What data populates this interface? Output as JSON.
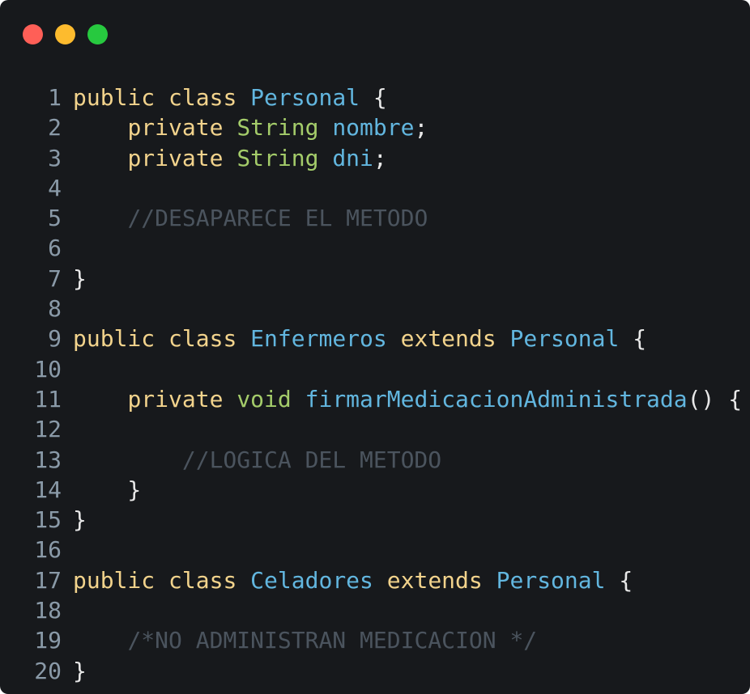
{
  "window": {
    "controls": [
      "close-button",
      "minimize-button",
      "maximize-button"
    ],
    "colors": {
      "background": "#17191c",
      "close": "#ff5f57",
      "minimize": "#fdbb2e",
      "maximize": "#27c93f"
    }
  },
  "code": {
    "line_numbers": [
      "1",
      "2",
      "3",
      "4",
      "5",
      "6",
      "7",
      "8",
      "9",
      "10",
      "11",
      "12",
      "13",
      "14",
      "15",
      "16",
      "17",
      "18",
      "19",
      "20"
    ],
    "lines": [
      [
        {
          "t": "public",
          "c": "kw"
        },
        {
          "t": " ",
          "c": "pn"
        },
        {
          "t": "class",
          "c": "kw"
        },
        {
          "t": " ",
          "c": "pn"
        },
        {
          "t": "Personal",
          "c": "cls"
        },
        {
          "t": " {",
          "c": "pn"
        }
      ],
      [
        {
          "t": "    ",
          "c": "pn"
        },
        {
          "t": "private",
          "c": "kw"
        },
        {
          "t": " ",
          "c": "pn"
        },
        {
          "t": "String",
          "c": "type"
        },
        {
          "t": " ",
          "c": "pn"
        },
        {
          "t": "nombre",
          "c": "var"
        },
        {
          "t": ";",
          "c": "pn"
        }
      ],
      [
        {
          "t": "    ",
          "c": "pn"
        },
        {
          "t": "private",
          "c": "kw"
        },
        {
          "t": " ",
          "c": "pn"
        },
        {
          "t": "String",
          "c": "type"
        },
        {
          "t": " ",
          "c": "pn"
        },
        {
          "t": "dni",
          "c": "var"
        },
        {
          "t": ";",
          "c": "pn"
        }
      ],
      [],
      [
        {
          "t": "    ",
          "c": "pn"
        },
        {
          "t": "//DESAPARECE EL METODO",
          "c": "cm"
        }
      ],
      [],
      [
        {
          "t": "}",
          "c": "pn"
        }
      ],
      [],
      [
        {
          "t": "public",
          "c": "kw"
        },
        {
          "t": " ",
          "c": "pn"
        },
        {
          "t": "class",
          "c": "kw"
        },
        {
          "t": " ",
          "c": "pn"
        },
        {
          "t": "Enfermeros",
          "c": "cls"
        },
        {
          "t": " ",
          "c": "pn"
        },
        {
          "t": "extends",
          "c": "kw"
        },
        {
          "t": " ",
          "c": "pn"
        },
        {
          "t": "Personal",
          "c": "cls"
        },
        {
          "t": " {",
          "c": "pn"
        }
      ],
      [],
      [
        {
          "t": "    ",
          "c": "pn"
        },
        {
          "t": "private",
          "c": "kw"
        },
        {
          "t": " ",
          "c": "pn"
        },
        {
          "t": "void",
          "c": "type"
        },
        {
          "t": " ",
          "c": "pn"
        },
        {
          "t": "firmarMedicacionAdministrada",
          "c": "fn"
        },
        {
          "t": "() {",
          "c": "pn"
        }
      ],
      [],
      [
        {
          "t": "        ",
          "c": "pn"
        },
        {
          "t": "//LOGICA DEL METODO",
          "c": "cm"
        }
      ],
      [
        {
          "t": "    }",
          "c": "pn"
        }
      ],
      [
        {
          "t": "}",
          "c": "pn"
        }
      ],
      [],
      [
        {
          "t": "public",
          "c": "kw"
        },
        {
          "t": " ",
          "c": "pn"
        },
        {
          "t": "class",
          "c": "kw"
        },
        {
          "t": " ",
          "c": "pn"
        },
        {
          "t": "Celadores",
          "c": "cls"
        },
        {
          "t": " ",
          "c": "pn"
        },
        {
          "t": "extends",
          "c": "kw"
        },
        {
          "t": " ",
          "c": "pn"
        },
        {
          "t": "Personal",
          "c": "cls"
        },
        {
          "t": " {",
          "c": "pn"
        }
      ],
      [],
      [
        {
          "t": "    ",
          "c": "pn"
        },
        {
          "t": "/*NO ADMINISTRAN MEDICACION */",
          "c": "cm"
        }
      ],
      [
        {
          "t": "}",
          "c": "pn"
        }
      ]
    ]
  }
}
